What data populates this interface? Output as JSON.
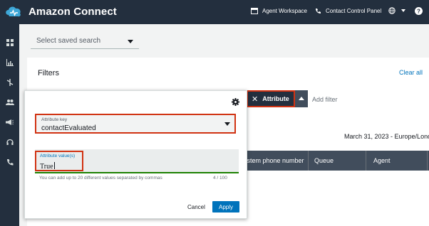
{
  "header": {
    "brand": "Amazon Connect",
    "agent_workspace": "Agent Workspace",
    "contact_control_panel": "Contact Control Panel"
  },
  "sidebar": {
    "icons": [
      "dashboard-icon",
      "bar-chart-icon",
      "routing-icon",
      "users-icon",
      "megaphone-icon",
      "headset-icon",
      "phone-icon"
    ]
  },
  "saved_search": {
    "placeholder": "Select saved search"
  },
  "filters": {
    "title": "Filters",
    "clear_all": "Clear all",
    "chip_label": "Attribute",
    "add_filter": "Add filter"
  },
  "results": {
    "date_range": "March 31, 2023 - Europe/Lond",
    "columns": [
      "ystem phone number",
      "Queue",
      "Agent"
    ]
  },
  "popup": {
    "key_label": "Attribute key",
    "key_value": "contactEvaluated",
    "values_label": "Attribute value(s)",
    "values_value": "True",
    "hint": "You can add up to 20 different values separated by commas",
    "counter": "4 / 100",
    "cancel": "Cancel",
    "apply": "Apply"
  },
  "colors": {
    "header_bg": "#232f3e",
    "accent_blue": "#0073bb",
    "highlight_red": "#d13212",
    "valid_green": "#1d8102"
  }
}
